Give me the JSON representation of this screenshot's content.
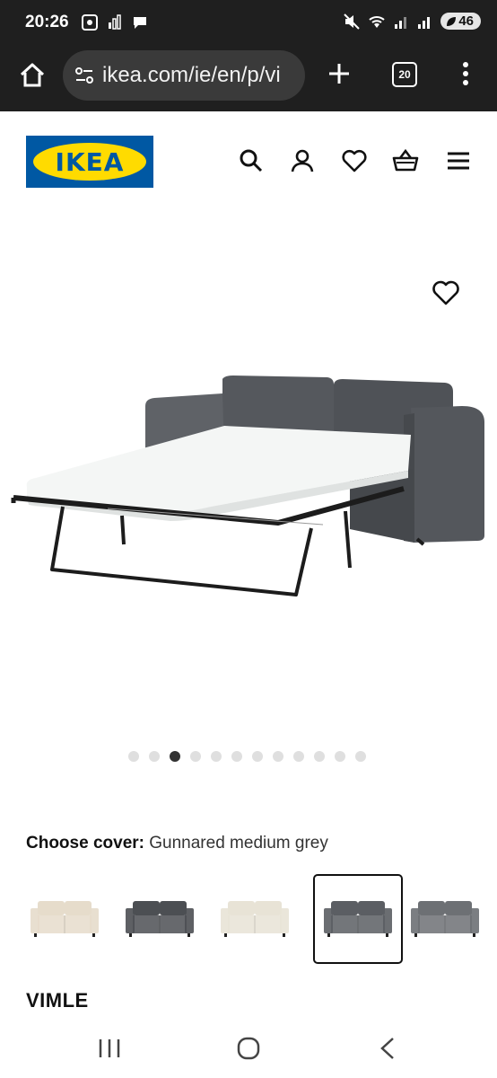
{
  "status_bar": {
    "time": "20:26",
    "battery": "46"
  },
  "browser": {
    "url": "ikea.com/ie/en/p/vi",
    "tab_count": "20"
  },
  "header": {
    "logo_text": "IKEA",
    "icons": [
      "search-icon",
      "account-icon",
      "heart-icon",
      "basket-icon",
      "hamburger-menu-icon"
    ]
  },
  "product": {
    "image_dots_total": 12,
    "image_dots_active_index": 2,
    "choose_cover_label": "Choose cover:",
    "choose_cover_value": "Gunnared medium grey",
    "swatches": [
      {
        "color": "#e6dccb",
        "selected": false
      },
      {
        "color": "#4c4f53",
        "selected": false
      },
      {
        "color": "#e8e3d6",
        "selected": false
      },
      {
        "color": "#5b5e63",
        "selected": true
      },
      {
        "color": "#6d7074",
        "selected": false
      }
    ],
    "name": "VIMLE"
  },
  "colors": {
    "ikea_blue": "#0058a3",
    "ikea_yellow": "#ffdb00",
    "sofa_grey": "#55585d"
  }
}
